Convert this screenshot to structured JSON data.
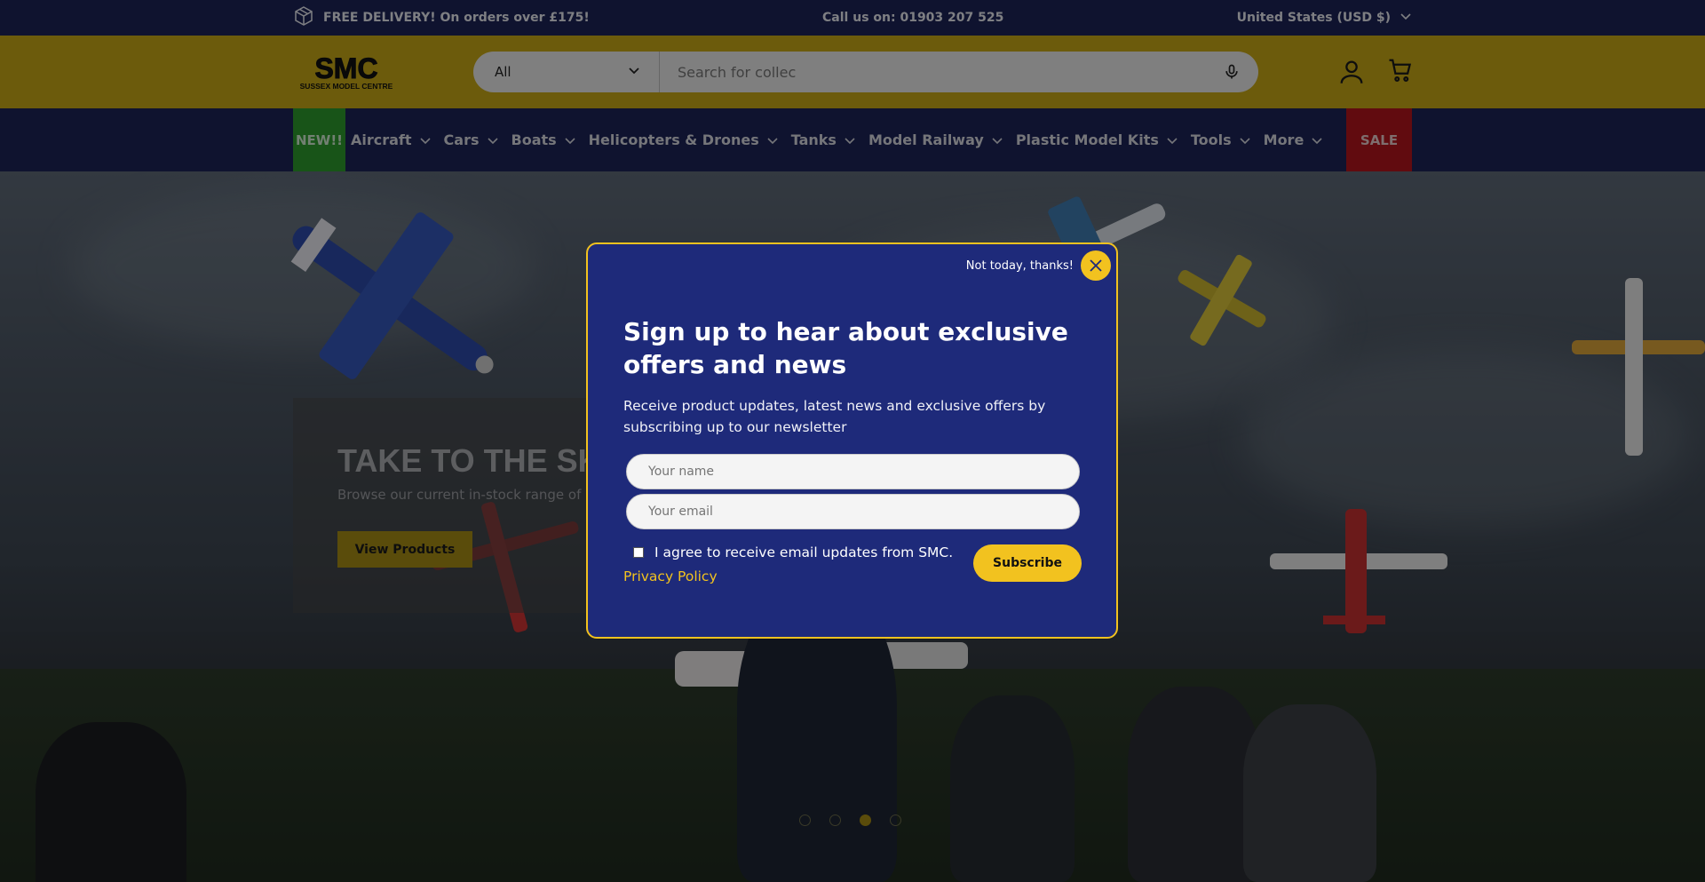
{
  "announcement": {
    "delivery": "FREE DELIVERY! On orders over £175!",
    "phone": "Call us on: 01903 207 525",
    "currency": "United States (USD $)"
  },
  "header": {
    "logo_text": "SMC",
    "logo_sub": "SUSSEX MODEL CENTRE",
    "search_category": "All",
    "search_placeholder": "Search for collec"
  },
  "nav": {
    "new_label": "NEW!!",
    "items": [
      "Aircraft",
      "Cars",
      "Boats",
      "Helicopters & Drones",
      "Tanks",
      "Model Railway",
      "Plastic Model Kits",
      "Tools",
      "More"
    ],
    "sale_label": "SALE"
  },
  "hero": {
    "title": "TAKE TO THE SKIE",
    "subtitle": "Browse our current in-stock range of a",
    "button": "View Products",
    "slides_total": 4,
    "active_slide": 3
  },
  "popup": {
    "dismiss_text": "Not today, thanks!",
    "title": "Sign up to hear about exclusive offers and news",
    "description": "Receive product updates, latest news and exclusive offers by subscribing up to our newsletter",
    "name_placeholder": "Your name",
    "email_placeholder": "Your email",
    "agree_text": "I agree to receive email updates from SMC.",
    "privacy_link": "Privacy Policy",
    "subscribe_button": "Subscribe"
  },
  "colors": {
    "navy": "#1d2356",
    "mustard": "#c5a616",
    "popup_bg": "#1e2a7a",
    "accent_yellow": "#f2c21f",
    "new_green": "#2c9a2c",
    "sale_red": "#b1141c"
  }
}
